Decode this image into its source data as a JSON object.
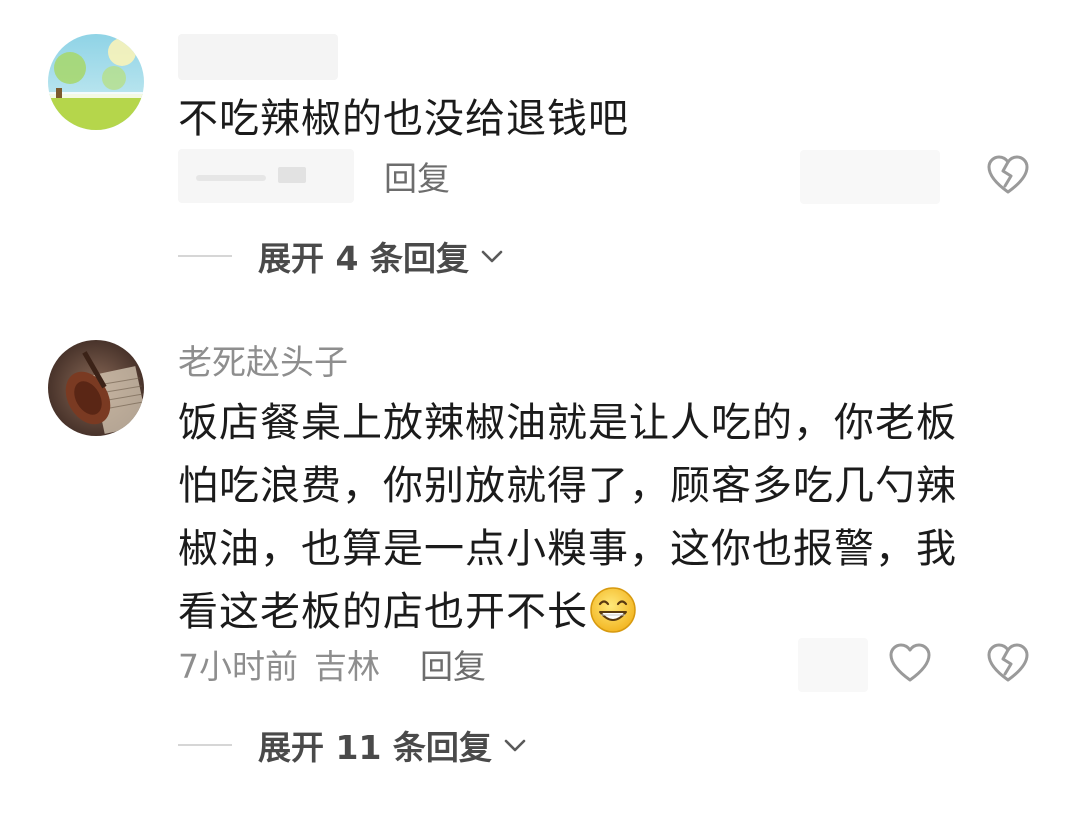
{
  "comments": [
    {
      "username": "",
      "text_lines": [
        "不吃辣椒的也没给退钱吧"
      ],
      "time": "",
      "location": "",
      "reply_label": "回复",
      "expand_label": "展开 4 条回复",
      "icons": {
        "dislike": "broken-heart-icon",
        "expand": "chevron-down-icon"
      }
    },
    {
      "username": "老死赵头子",
      "text_lines": [
        "饭店餐桌上放辣椒油就是让人吃的，你老板",
        "怕吃浪费，你别放就得了，顾客多吃几勺辣",
        "椒油，也算是一点小糗事，这你也报警，我",
        "看这老板的店也开不长"
      ],
      "emoji": "grinning-face-emoji",
      "time": "7小时前",
      "location": "吉林",
      "reply_label": "回复",
      "expand_label": "展开 11 条回复",
      "icons": {
        "like": "heart-icon",
        "dislike": "broken-heart-icon",
        "expand": "chevron-down-icon"
      }
    }
  ],
  "colors": {
    "text_primary": "#1b1b1b",
    "text_secondary": "#8e8e8e",
    "icon": "#9a9a9a"
  }
}
